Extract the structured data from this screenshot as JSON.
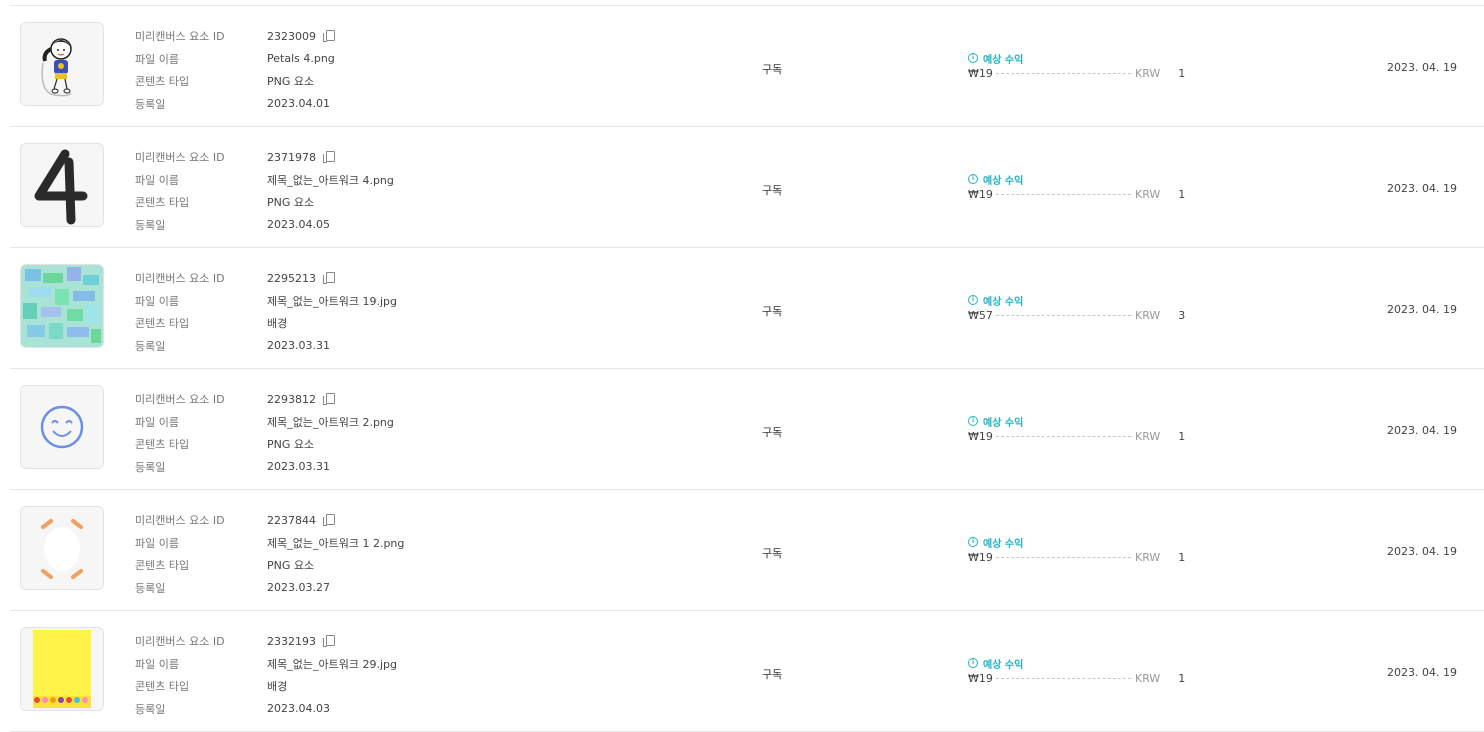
{
  "labels": {
    "element_id": "미리캔버스 요소 ID",
    "file_name": "파일 이름",
    "content_type": "콘텐츠 타입",
    "registered": "등록일",
    "expected_revenue": "예상 수익",
    "currency": "KRW"
  },
  "rows": [
    {
      "id": "2323009",
      "file": "Petals 4.png",
      "type": "PNG 요소",
      "reg": "2023.04.01",
      "plan": "구독",
      "amount": "₩19",
      "count": "1",
      "date": "2023. 04. 19",
      "thumb": "girl-jump-rope"
    },
    {
      "id": "2371978",
      "file": "제목_없는_아트워크 4.png",
      "type": "PNG 요소",
      "reg": "2023.04.05",
      "plan": "구독",
      "amount": "₩19",
      "count": "1",
      "date": "2023. 04. 19",
      "thumb": "number-four"
    },
    {
      "id": "2295213",
      "file": "제목_없는_아트워크 19.jpg",
      "type": "배경",
      "reg": "2023.03.31",
      "plan": "구독",
      "amount": "₩57",
      "count": "3",
      "date": "2023. 04. 19",
      "thumb": "mosaic-pattern"
    },
    {
      "id": "2293812",
      "file": "제목_없는_아트워크 2.png",
      "type": "PNG 요소",
      "reg": "2023.03.31",
      "plan": "구독",
      "amount": "₩19",
      "count": "1",
      "date": "2023. 04. 19",
      "thumb": "smiley-face"
    },
    {
      "id": "2237844",
      "file": "제목_없는_아트워크 1 2.png",
      "type": "PNG 요소",
      "reg": "2023.03.27",
      "plan": "구독",
      "amount": "₩19",
      "count": "1",
      "date": "2023. 04. 19",
      "thumb": "corner-marks"
    },
    {
      "id": "2332193",
      "file": "제목_없는_아트워크 29.jpg",
      "type": "배경",
      "reg": "2023.04.03",
      "plan": "구독",
      "amount": "₩19",
      "count": "1",
      "date": "2023. 04. 19",
      "thumb": "yellow-flowers"
    }
  ]
}
